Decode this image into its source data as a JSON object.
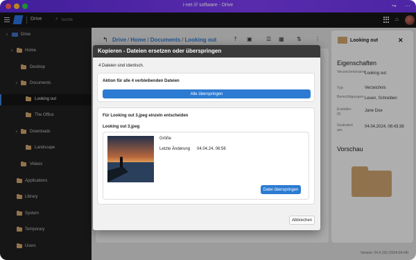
{
  "window": {
    "title": "i-net /// software - Drive"
  },
  "appbar": {
    "app_name": "Drive",
    "search_placeholder": "Suche"
  },
  "sidebar": {
    "items": [
      {
        "label": "Drive"
      },
      {
        "label": "Home"
      },
      {
        "label": "Desktop"
      },
      {
        "label": "Documents"
      },
      {
        "label": "Looking out"
      },
      {
        "label": "The Office"
      },
      {
        "label": "Downloads"
      },
      {
        "label": "Landscape"
      },
      {
        "label": "Videos"
      },
      {
        "label": "Applications"
      },
      {
        "label": "Library"
      },
      {
        "label": "System"
      },
      {
        "label": "Temporary"
      },
      {
        "label": "Users"
      }
    ],
    "active_item": "Looking out"
  },
  "breadcrumb": [
    "Drive",
    "Home",
    "Documents",
    "Looking out"
  ],
  "details": {
    "title": "Looking out",
    "properties_heading": "Eigenschaften",
    "rows": [
      {
        "label": "Verzeichnisname",
        "value": "Looking out"
      },
      {
        "label": "Typ",
        "value": "Verzeichnis"
      },
      {
        "label": "Berechtigungen",
        "value": "Lesen, Schreiben"
      },
      {
        "label": "Ersteller-ID",
        "value": "Jane Doe"
      },
      {
        "label": "Geändert am",
        "value": "04.04.2024, 06:43:38"
      }
    ],
    "preview_heading": "Vorschau",
    "version": "Version: 24.4.192 (2024-04-04)"
  },
  "modal": {
    "title": "Kopieren - Dateien ersetzen oder überspringen",
    "info": "4 Dateien sind identisch.",
    "bulk_heading": "Aktion für alle 4 verbleibenden Dateien",
    "skip_all_label": "Alle überspringen",
    "single_heading": "Für Looking out 3.jpeg einzeln entscheiden",
    "file_name": "Looking out 3.jpeg",
    "size_label": "Größe",
    "changed_label": "Letzte Änderung",
    "changed_value": "04.04.24, 06:56",
    "skip_file_label": "Datei überspringen",
    "cancel_label": "Abbrechen"
  },
  "colors": {
    "accent": "#2c7bd2",
    "titlebar": "#6a34e4",
    "sidebar_bg": "#1f1f1f"
  }
}
